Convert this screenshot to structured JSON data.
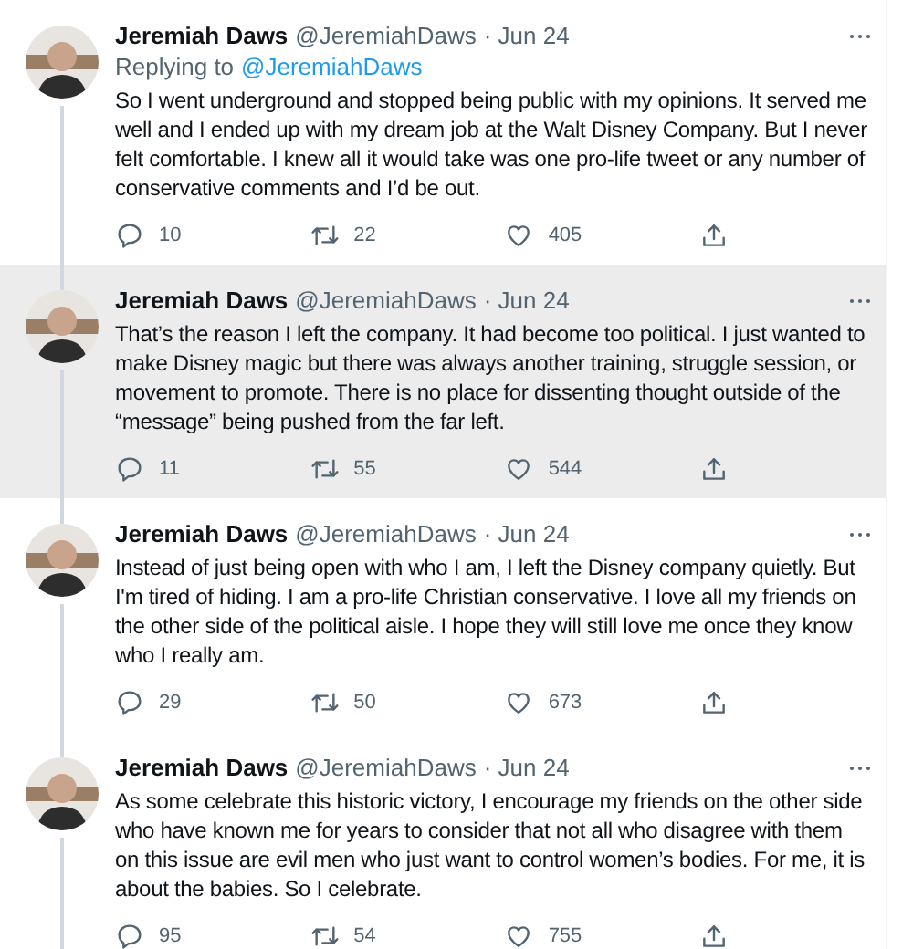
{
  "tweets": [
    {
      "name": "Jeremiah Daws",
      "handle": "@JeremiahDaws",
      "date": "· Jun 24",
      "replying_label": "Replying to",
      "replying_to": "@JeremiahDaws",
      "text": "So I went underground and stopped being public with my opinions. It served me well and I ended up with my dream job at the Walt Disney Company. But I never felt comfortable. I knew all it would take was one pro-life tweet or any number of conservative comments and I’d be out.",
      "replies": "10",
      "retweets": "22",
      "likes": "405",
      "highlighted": false
    },
    {
      "name": "Jeremiah Daws",
      "handle": "@JeremiahDaws",
      "date": "· Jun 24",
      "text": "That’s the reason I left the company. It had become too political. I just wanted to make Disney magic but there was always another training, struggle session, or movement to promote. There is no place for dissenting thought outside of the “message” being pushed from the far left.",
      "replies": "11",
      "retweets": "55",
      "likes": "544",
      "highlighted": true
    },
    {
      "name": "Jeremiah Daws",
      "handle": "@JeremiahDaws",
      "date": "· Jun 24",
      "text": "Instead of just being open with who I am, I left the Disney company quietly. But I'm tired of hiding. I am a pro-life Christian conservative. I love all my friends on the other side of the political aisle. I hope they will still love me once they know who I really am.",
      "replies": "29",
      "retweets": "50",
      "likes": "673",
      "highlighted": false
    },
    {
      "name": "Jeremiah Daws",
      "handle": "@JeremiahDaws",
      "date": "· Jun 24",
      "text": "As some celebrate this historic victory, I encourage my friends on the other side who have known me for years to consider that not all who disagree with them on this issue are evil men who just want to control women’s bodies. For me, it is about the babies.  So I celebrate.",
      "replies": "95",
      "retweets": "54",
      "likes": "755",
      "highlighted": false
    }
  ]
}
